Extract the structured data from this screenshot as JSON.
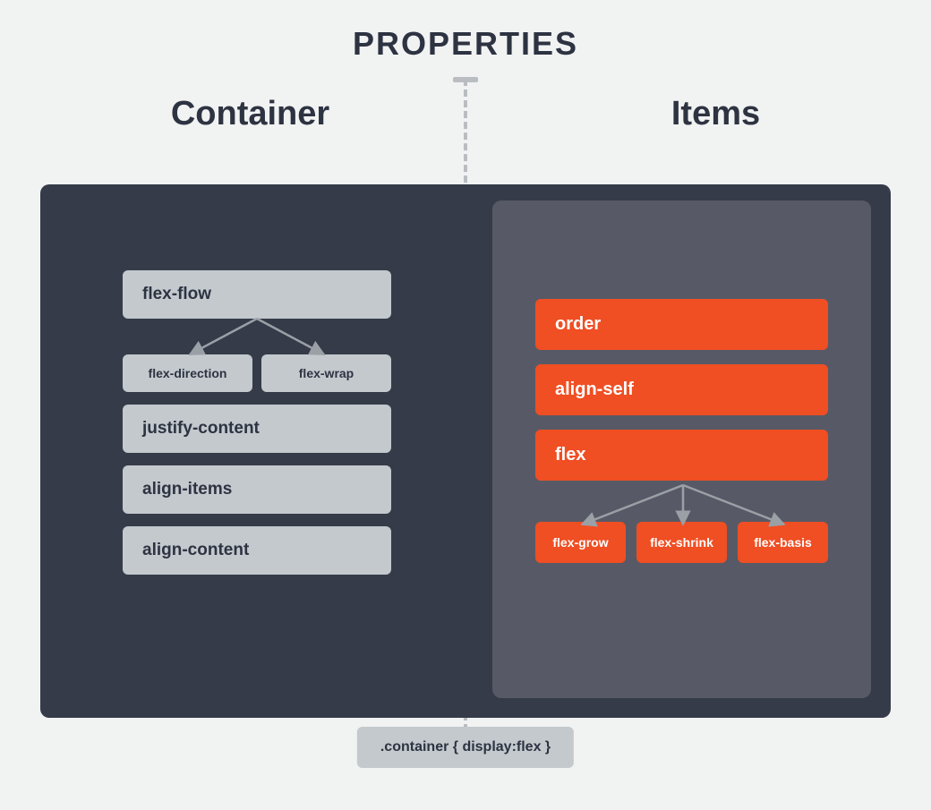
{
  "title": "PROPERTIES",
  "headings": {
    "left": "Container",
    "right": "Items"
  },
  "container": {
    "flex_flow": "flex-flow",
    "flex_direction": "flex-direction",
    "flex_wrap": "flex-wrap",
    "justify_content": "justify-content",
    "align_items": "align-items",
    "align_content": "align-content"
  },
  "items": {
    "order": "order",
    "align_self": "align-self",
    "flex": "flex",
    "flex_grow": "flex-grow",
    "flex_shrink": "flex-shrink",
    "flex_basis": "flex-basis"
  },
  "footer_code": ".container { display:flex }"
}
